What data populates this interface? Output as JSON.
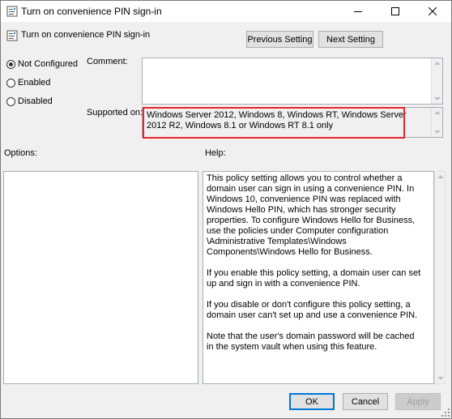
{
  "window": {
    "title": "Turn on convenience PIN sign-in"
  },
  "header": {
    "policy_name": "Turn on convenience PIN sign-in",
    "prev_label": "Previous Setting",
    "next_label": "Next Setting"
  },
  "state": {
    "options": [
      {
        "label": "Not Configured",
        "selected": true
      },
      {
        "label": "Enabled",
        "selected": false
      },
      {
        "label": "Disabled",
        "selected": false
      }
    ]
  },
  "comment": {
    "label": "Comment:",
    "value": ""
  },
  "supported": {
    "label": "Supported on:",
    "value": "Windows Server 2012, Windows 8, Windows RT, Windows Server 2012 R2, Windows 8.1 or Windows RT 8.1 only"
  },
  "options_pane": {
    "label": "Options:"
  },
  "help_pane": {
    "label": "Help:",
    "paragraphs": [
      "This policy setting allows you to control whether a domain user can sign in using a convenience PIN. In Windows 10, convenience PIN was replaced with Windows Hello PIN, which has stronger security properties. To configure Windows Hello for Business, use the policies under Computer configuration \\Administrative Templates\\Windows Components\\Windows Hello for Business.",
      "If you enable this policy setting, a domain user can set up and sign in with a convenience PIN.",
      "If you disable or don't configure this policy setting, a domain user can't set up and use a convenience PIN.",
      "Note that the user's domain password will be cached in the system vault when using this feature."
    ]
  },
  "footer": {
    "ok_label": "OK",
    "cancel_label": "Cancel",
    "apply_label": "Apply"
  },
  "colors": {
    "highlight": "#e8242a",
    "default_button_border": "#0078d7"
  }
}
